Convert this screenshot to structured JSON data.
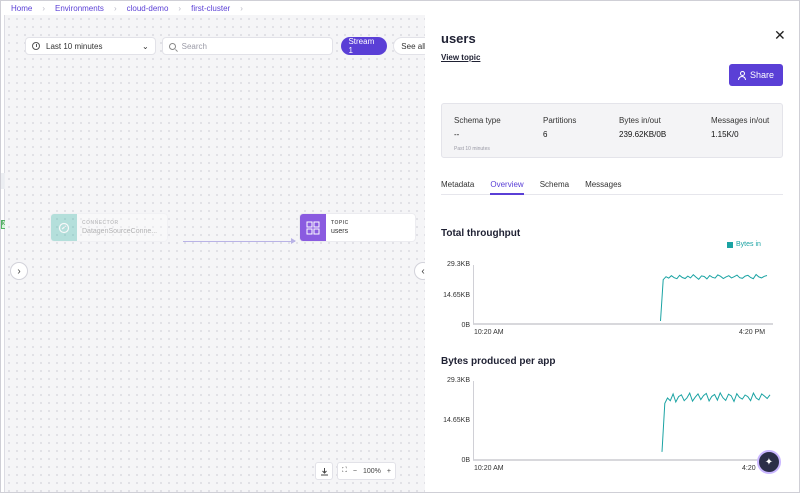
{
  "breadcrumb": [
    "Home",
    "Environments",
    "cloud-demo",
    "first-cluster"
  ],
  "canvas": {
    "time_range": "Last 10 minutes",
    "search_placeholder": "Search",
    "stream_button": "Stream 1",
    "see_all_button": "See all st",
    "connector_node": {
      "type": "CONNECTOR",
      "name": "DatagenSourceConne..."
    },
    "topic_node": {
      "type": "TOPIC",
      "name": "users"
    },
    "zoom_level": "100%"
  },
  "panel": {
    "title": "users",
    "view_topic": "View topic",
    "share_label": "Share",
    "stats": [
      {
        "label": "Schema type",
        "value": "--"
      },
      {
        "label": "Partitions",
        "value": "6"
      },
      {
        "label": "Bytes in/out",
        "value": "239.62KB/0B"
      },
      {
        "label": "Messages in/out",
        "value": "1.15K/0"
      }
    ],
    "stats_note": "Past 10 minutes",
    "tabs": [
      "Metadata",
      "Overview",
      "Schema",
      "Messages"
    ],
    "active_tab": "Overview"
  },
  "throughput": {
    "title": "Total throughput",
    "legend": "Bytes in",
    "y_ticks": [
      "29.3KB",
      "14.65KB",
      "0B"
    ],
    "x_start": "10:20 AM",
    "x_end": "4:20 PM"
  },
  "produced": {
    "title": "Bytes produced per app",
    "y_ticks": [
      "29.3KB",
      "14.65KB",
      "0B"
    ],
    "x_start": "10:20 AM",
    "x_end": "4:20"
  },
  "colors": {
    "accent": "#5a3fd6",
    "series": "#1aa3a3"
  },
  "chart_data": [
    {
      "type": "line",
      "title": "Total throughput",
      "ylim": [
        0,
        29.3
      ],
      "ylabel": "",
      "series": [
        {
          "name": "Bytes in",
          "values": [
            1.5,
            22,
            23.5,
            22.8,
            24,
            23,
            22.5,
            24.2,
            23.1,
            22.6,
            23.8,
            22.9,
            24.5,
            23.3,
            22.2,
            23.9,
            23.6,
            22.4,
            24.1,
            23.2,
            22.8,
            24.4,
            23.7,
            22.6,
            23.4,
            24.0,
            22.9,
            23.5,
            24.3,
            23.0,
            22.7,
            23.8,
            24.2,
            23.1,
            22.5,
            24.6,
            23.4,
            22.9,
            23.7,
            24.1
          ]
        }
      ]
    },
    {
      "type": "line",
      "title": "Bytes produced per app",
      "ylim": [
        0,
        29.3
      ],
      "series": [
        {
          "values": [
            3,
            21,
            23,
            22,
            24.5,
            21.5,
            23.5,
            24.2,
            22,
            23,
            24.8,
            21.8,
            23.3,
            24.5,
            22.4,
            23.9,
            24.7,
            21.9,
            23.6,
            24.3,
            22.2,
            24.9,
            23.1,
            22.1,
            24.4,
            23.8,
            21.7,
            24.6,
            23.2,
            22.6,
            24.1,
            23.5,
            22.0,
            24.8,
            23.0,
            22.3,
            24.5,
            23.7,
            22.8,
            24.2
          ]
        }
      ]
    }
  ]
}
